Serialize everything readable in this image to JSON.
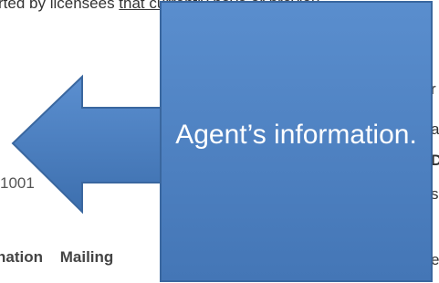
{
  "background": {
    "top_line_start": "rted by licensees ",
    "top_line_link": "that currently have or previou",
    "zip_fragment": "1001",
    "tabs": [
      "nation",
      "Mailing"
    ],
    "right_edge_chars": [
      "r",
      "a",
      "D",
      "s",
      "e"
    ]
  },
  "callout": {
    "label": "Agent’s information.",
    "fill_color": "#4a7ebb",
    "border_color": "#3a679f"
  }
}
